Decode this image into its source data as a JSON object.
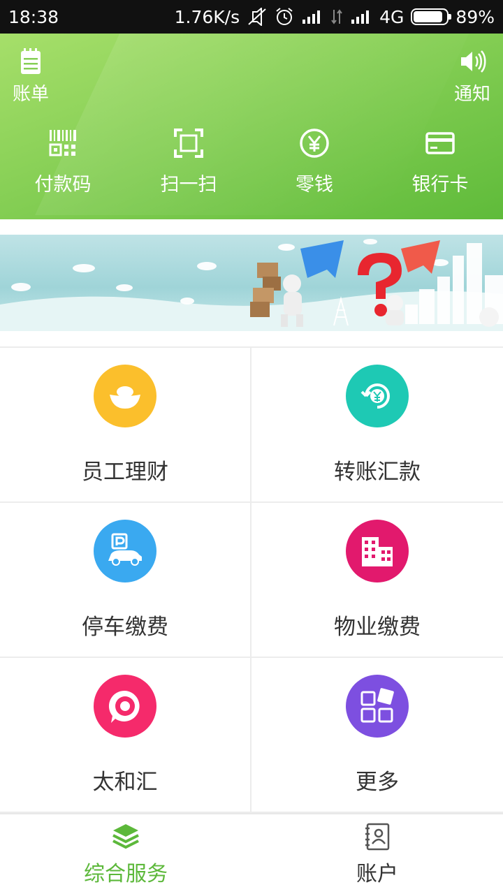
{
  "status_bar": {
    "time": "18:38",
    "speed": "1.76K/s",
    "network": "4G",
    "battery": "89%",
    "battery_level": 0.89
  },
  "header": {
    "bill_label": "账单",
    "notify_label": "通知",
    "quick_actions": [
      {
        "label": "付款码",
        "icon": "barcode-icon"
      },
      {
        "label": "扫一扫",
        "icon": "scan-icon"
      },
      {
        "label": "零钱",
        "icon": "yuan-coin-icon"
      },
      {
        "label": "银行卡",
        "icon": "bank-card-icon"
      }
    ],
    "colors": {
      "top": "#a6df6a",
      "bottom": "#5fbb3a"
    }
  },
  "grid": {
    "items": [
      {
        "label": "员工理财",
        "icon": "gold-ingot-icon",
        "color": "#fbbf2c"
      },
      {
        "label": "转账汇款",
        "icon": "yuan-transfer-icon",
        "color": "#1ec9b4"
      },
      {
        "label": "停车缴费",
        "icon": "parking-car-icon",
        "color": "#3aa9f0"
      },
      {
        "label": "物业缴费",
        "icon": "building-icon",
        "color": "#e2196d"
      },
      {
        "label": "太和汇",
        "icon": "target-chat-icon",
        "color": "#f52a6b"
      },
      {
        "label": "更多",
        "icon": "more-grid-icon",
        "color": "#7d4fe0"
      }
    ]
  },
  "tabbar": {
    "tabs": [
      {
        "label": "综合服务",
        "icon": "layers-icon",
        "active": true
      },
      {
        "label": "账户",
        "icon": "contact-book-icon",
        "active": false
      }
    ],
    "active_color": "#5cb83a"
  }
}
